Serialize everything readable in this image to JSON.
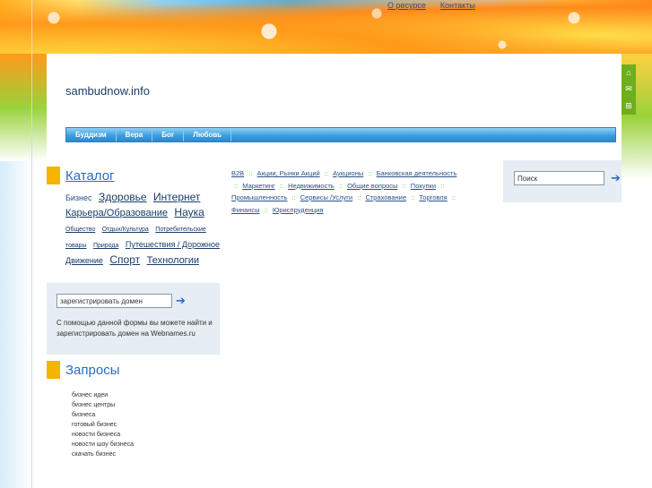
{
  "top_nav": [
    "О ресурсе",
    "Контакты"
  ],
  "site_title": "sambudnow.info",
  "menu": [
    "Буддизм",
    "Вера",
    "Бог",
    "Любовь"
  ],
  "side_icons": [
    "home-icon",
    "mail-icon",
    "sitemap-icon"
  ],
  "catalog": {
    "title": "Каталог",
    "tags": [
      {
        "text": "Бизнес",
        "size": 2,
        "plain": true
      },
      {
        "text": "Здоровье",
        "size": 4
      },
      {
        "text": "Интернет",
        "size": 4
      },
      {
        "text": "Карьера/Образование",
        "size": 3
      },
      {
        "text": "Наука",
        "size": 4
      },
      {
        "text": "Общество",
        "size": 1
      },
      {
        "text": "Отдых/Культура",
        "size": 1
      },
      {
        "text": "Потребительские товары",
        "size": 1
      },
      {
        "text": "Природа",
        "size": 1
      },
      {
        "text": "Путешествия / Дорожное Движение",
        "size": 2
      },
      {
        "text": "Спорт",
        "size": 4
      },
      {
        "text": "Технологии",
        "size": 3
      }
    ]
  },
  "domain_form": {
    "input_value": "зарегистрировать домен",
    "description": "С помощью данной формы вы можете найти и зарегистрировать домен на Webnames.ru"
  },
  "queries": {
    "title": "Запросы",
    "items": [
      "бизнес идеи",
      "бизнес центры",
      "бизнеса",
      "готовый бизнес",
      "новости бизнеса",
      "новости шоу бизнеса",
      "скачать бизнес"
    ]
  },
  "links": [
    "B2B",
    "Акции, Рынки Акций",
    "Аукционы",
    "Банковская деятельность",
    "Маркетинг",
    "Недвижимость",
    "Общие вопросы",
    "Покупки",
    "Промышленность",
    "Сервисы /Услуги",
    "Страхование",
    "Торговля",
    "Финансы",
    "Юриспруденция"
  ],
  "search": {
    "input_value": "Поиск"
  },
  "colors": {
    "accent_blue": "#2a6cc0",
    "marker_yellow": "#f5b400",
    "link_sep_green": "#6fb52a"
  }
}
